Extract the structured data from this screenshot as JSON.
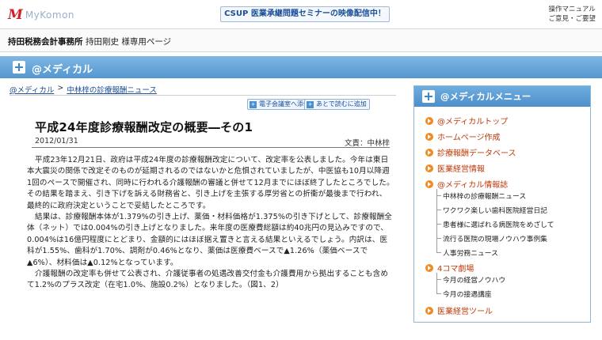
{
  "topbar": {
    "logo_mark": "M",
    "logo_text": "MyKomon",
    "promo": "CSUP 医業承継問題セミナーの映像配信中！",
    "links": [
      "操作マニュアル",
      "ご意見・ご要望"
    ]
  },
  "firm": {
    "name": "持田税務会計事務所",
    "page": "持田剛史 様専用ページ"
  },
  "band": {
    "title": "@メディカル"
  },
  "breadcrumb": {
    "items": [
      "@メディカル",
      "中林梓の診療報酬ニュース"
    ],
    "separator": ">"
  },
  "actions": {
    "attach": "電子会議室へ添付",
    "later": "あとで読むに追加"
  },
  "article": {
    "title": "平成24年度診療報酬改定の概要―その1",
    "date": "2012/01/31",
    "author": "文責：中林梓",
    "paragraphs": [
      "平成23年12月21日、政府は平成24年度の診療報酬改定について、改定率を公表しました。今年は東日本大震災の関係で改定そのものが延期されるのではないかと危惧されていましたが、中医協も10月以降週1回のペースで開催され、同時に行われる介護報酬の審議と併せて12月までにほぼ終了したところでした。その結果を踏まえ、引き下げを訴える財務省と、引き上げを主張する厚労省との折衝が最後まで行われ、最終的に政府決定ということで妥結したところです。",
      "結果は、診療報酬本体が1.379%の引き上げ、薬価・材料価格が1.375%の引き下げとして、診療報酬全体（ネット）では0.004%の引き上げとなりました。来年度の医療費総額は約40兆円の見込みですので、0.004%は16億円程度にとどまり、金額的にはほぼ据え置きと言える結果といえるでしょう。内訳は、医科が1.55%、歯科が1.70%、調剤が0.46%となり、薬価は医療費ベースで▲1.26%（薬価ベースで▲6%）、材料価は▲0.12%となっています。",
      "介護報酬の改定率も併せて公表され、介護従事者の処遇改善交付金も介護費用から拠出することも含めて1.2%のプラス改定（在宅1.0%、施設0.2%）となりました。（図1、2）"
    ]
  },
  "menu": {
    "title": "@メディカルメニュー",
    "items": [
      "@メディカルトップ",
      "ホームページ作成",
      "診療報酬データベース",
      "医業経営情報",
      "@メディカル情報誌",
      "4コマ劇場",
      "医業経営ツール"
    ],
    "journal_subitems": [
      "中林梓の診療報酬ニュース",
      "ワクワク楽しい歯科医院経営日記",
      "患者様に選ばれる病医院をめざして",
      "流行る医院の現場ノウハウ事例集",
      "人事労務ニュース"
    ],
    "theater_subitems": [
      "今月の経営ノウハウ",
      "今月の接遇講座"
    ]
  },
  "colors": {
    "accent_blue": "#5497cf",
    "menu_orange": "#f08a24",
    "link_blue": "#1a4e98",
    "menu_text": "#c0390b",
    "logo_red": "#d21f2a"
  }
}
